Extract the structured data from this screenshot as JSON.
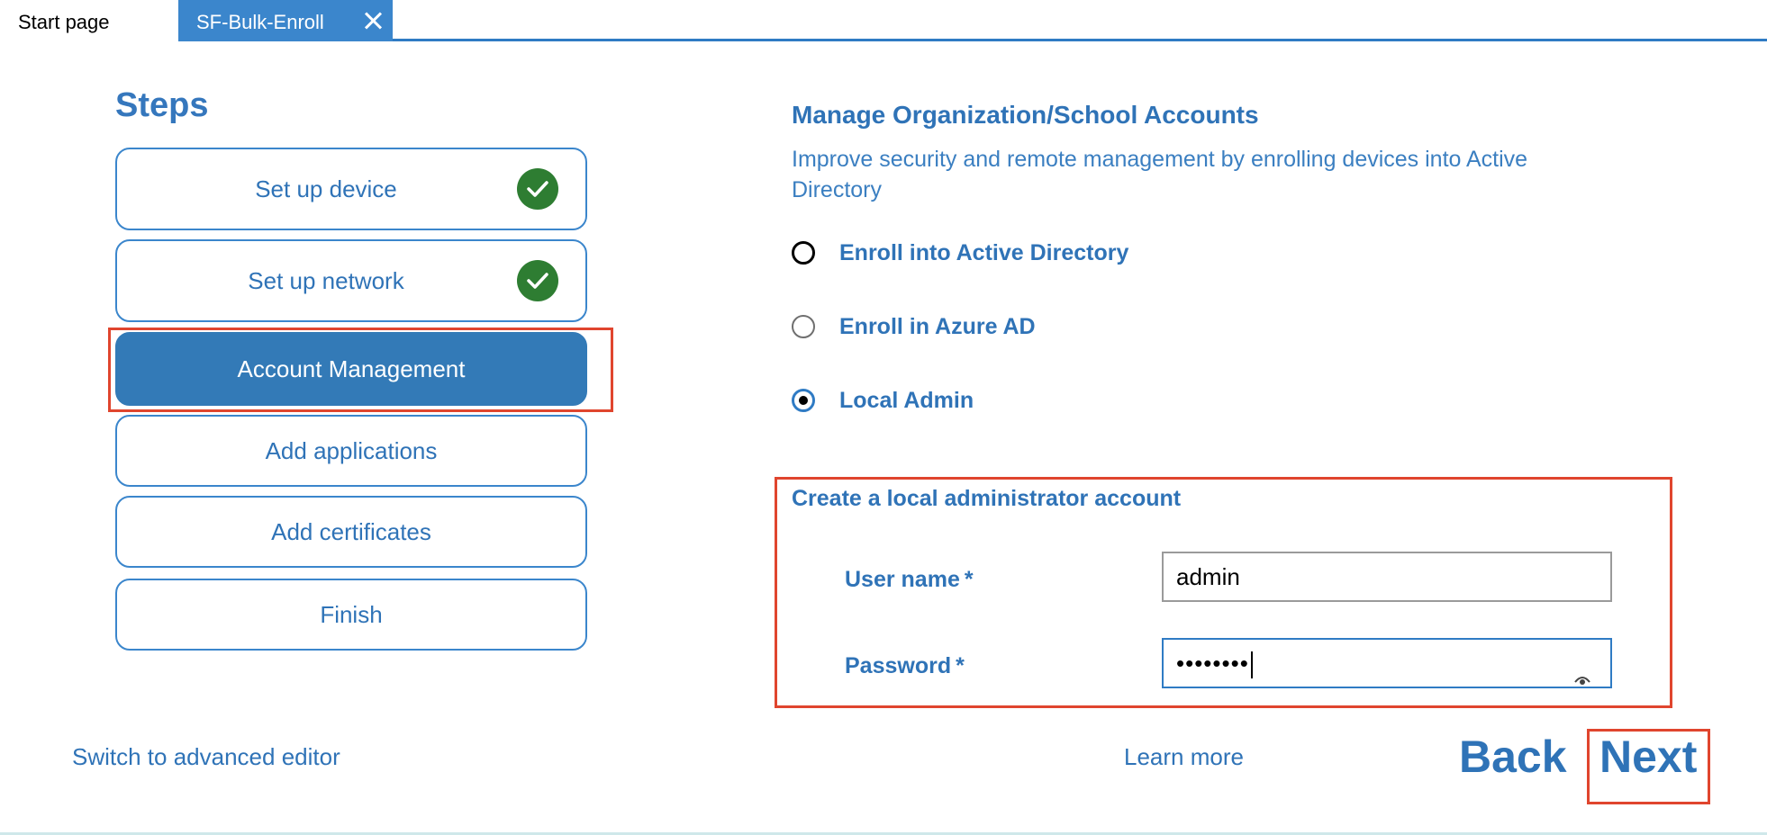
{
  "tabs": [
    {
      "label": "Start page",
      "active": false
    },
    {
      "label": "SF-Bulk-Enroll",
      "active": true
    }
  ],
  "steps": {
    "title": "Steps",
    "items": [
      {
        "label": "Set up device",
        "completed": true
      },
      {
        "label": "Set up network",
        "completed": true
      },
      {
        "label": "Account Management",
        "active": true
      },
      {
        "label": "Add applications"
      },
      {
        "label": "Add certificates"
      },
      {
        "label": "Finish"
      }
    ],
    "advanced_link": "Switch to advanced editor"
  },
  "panel": {
    "title": "Manage Organization/School Accounts",
    "description": "Improve security and remote management by enrolling devices into Active Directory",
    "options": [
      {
        "label": "Enroll into Active Directory",
        "selected": false
      },
      {
        "label": "Enroll in Azure AD",
        "selected": false
      },
      {
        "label": "Local Admin",
        "selected": true
      }
    ],
    "local_admin": {
      "title": "Create a local administrator account",
      "username_label": "User name",
      "username_value": "admin",
      "password_label": "Password",
      "password_masked": "••••••••",
      "required_mark": "*"
    }
  },
  "footer": {
    "learn_more": "Learn more",
    "back": "Back",
    "next": "Next"
  },
  "colors": {
    "accent": "#2f73b7",
    "active_tab": "#3b86cc",
    "check": "#2e7d32",
    "highlight": "#e0452e"
  }
}
